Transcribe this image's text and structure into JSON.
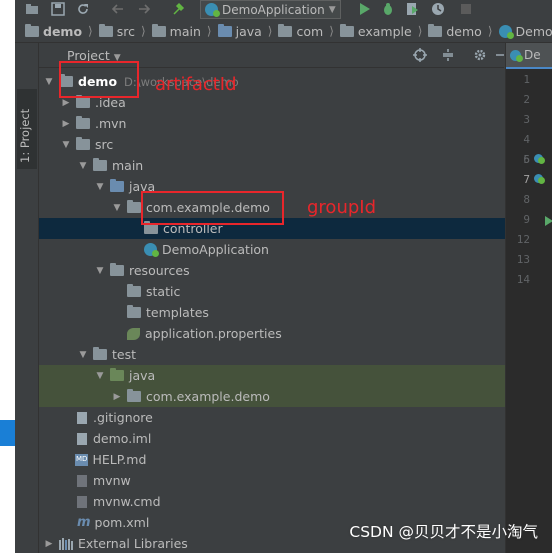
{
  "toolbar": {
    "run_config": "DemoApplication",
    "icons": [
      "folder-icon",
      "save-icon",
      "sync-icon",
      "back-icon",
      "forward-icon",
      "build-icon",
      "run-icon",
      "debug-icon",
      "coverage-icon",
      "profile-icon",
      "stop-icon"
    ]
  },
  "breadcrumb": [
    "demo",
    "src",
    "main",
    "java",
    "com",
    "example",
    "demo",
    "DemoApplic"
  ],
  "side_strip": {
    "label": "1: Project"
  },
  "panel": {
    "title": "Project"
  },
  "tree": [
    {
      "label": "demo",
      "path": "D:\\workspace\\demo",
      "kind": "project",
      "indent": 0,
      "arrow": "down"
    },
    {
      "label": ".idea",
      "kind": "folder",
      "indent": 1,
      "arrow": "right"
    },
    {
      "label": ".mvn",
      "kind": "folder",
      "indent": 1,
      "arrow": "right"
    },
    {
      "label": "src",
      "kind": "folder",
      "indent": 1,
      "arrow": "down"
    },
    {
      "label": "main",
      "kind": "folder",
      "indent": 2,
      "arrow": "down"
    },
    {
      "label": "java",
      "kind": "source-folder",
      "indent": 3,
      "arrow": "down"
    },
    {
      "label": "com.example.demo",
      "kind": "package",
      "indent": 4,
      "arrow": "down"
    },
    {
      "label": "controller",
      "kind": "package",
      "indent": 5,
      "arrow": "",
      "selected": true
    },
    {
      "label": "DemoApplication",
      "kind": "class",
      "indent": 5,
      "arrow": ""
    },
    {
      "label": "resources",
      "kind": "resources-folder",
      "indent": 3,
      "arrow": "down"
    },
    {
      "label": "static",
      "kind": "folder",
      "indent": 4,
      "arrow": ""
    },
    {
      "label": "templates",
      "kind": "folder",
      "indent": 4,
      "arrow": ""
    },
    {
      "label": "application.properties",
      "kind": "properties",
      "indent": 4,
      "arrow": ""
    },
    {
      "label": "test",
      "kind": "folder",
      "indent": 2,
      "arrow": "down"
    },
    {
      "label": "java",
      "kind": "test-folder",
      "indent": 3,
      "arrow": "down",
      "highlight": true
    },
    {
      "label": "com.example.demo",
      "kind": "package",
      "indent": 4,
      "arrow": "right",
      "highlight": true
    },
    {
      "label": ".gitignore",
      "kind": "file",
      "indent": 1,
      "arrow": ""
    },
    {
      "label": "demo.iml",
      "kind": "file",
      "indent": 1,
      "arrow": ""
    },
    {
      "label": "HELP.md",
      "kind": "markdown",
      "indent": 1,
      "arrow": ""
    },
    {
      "label": "mvnw",
      "kind": "file",
      "indent": 1,
      "arrow": ""
    },
    {
      "label": "mvnw.cmd",
      "kind": "file",
      "indent": 1,
      "arrow": ""
    },
    {
      "label": "pom.xml",
      "kind": "maven",
      "indent": 1,
      "arrow": ""
    },
    {
      "label": "External Libraries",
      "kind": "libraries",
      "indent": 0,
      "arrow": "right"
    }
  ],
  "editor": {
    "tab_label": "De",
    "line_numbers": [
      "1",
      "2",
      "3",
      "4",
      "5",
      "6",
      "7",
      "8",
      "9",
      "12",
      "13",
      "14"
    ],
    "active_line": "7"
  },
  "annotations": {
    "artifact_label": "artifactId",
    "group_label": "groupId",
    "color": "#e8262b"
  },
  "watermark": "CSDN @贝贝才不是小淘气"
}
